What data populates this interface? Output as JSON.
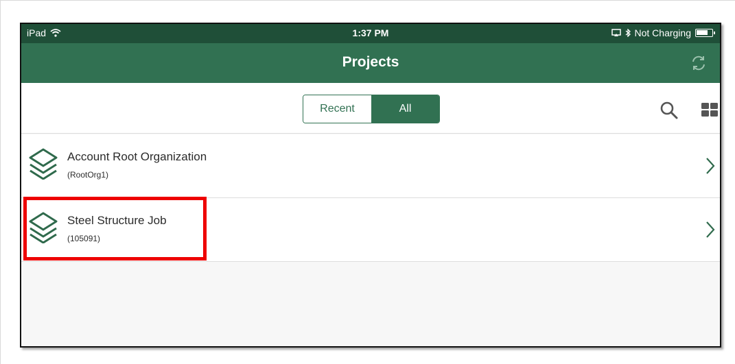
{
  "status_bar": {
    "carrier": "iPad",
    "time": "1:37 PM",
    "charging": "Not Charging"
  },
  "nav": {
    "title": "Projects",
    "sync_icon": "sync-icon"
  },
  "toolbar": {
    "segments": [
      "Recent",
      "All"
    ],
    "selected_segment": "All",
    "search_icon": "search-icon",
    "grid_icon": "grid-view-icon"
  },
  "projects": [
    {
      "name": "Account Root Organization",
      "code": "(RootOrg1)"
    },
    {
      "name": "Steel Structure Job",
      "code": "(105091)"
    }
  ],
  "colors": {
    "status_bar": "#1f4f38",
    "nav_bar": "#317152",
    "accent": "#317152",
    "highlight": "#ee0000"
  }
}
